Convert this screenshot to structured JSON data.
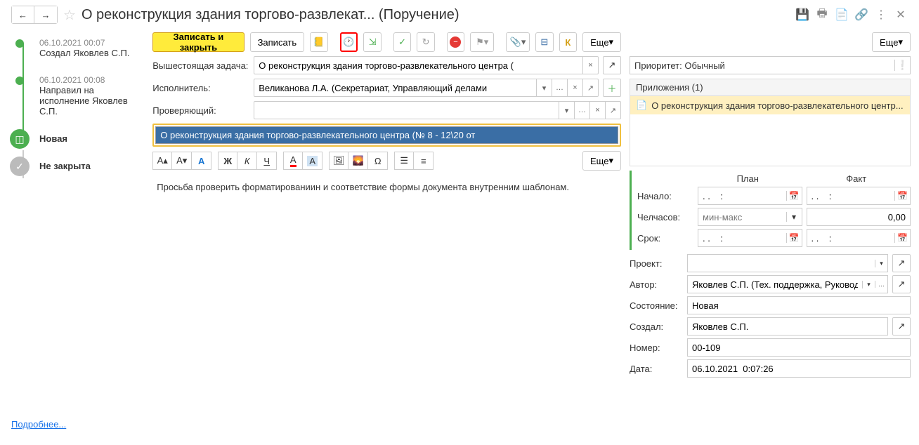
{
  "header": {
    "title": "О реконструкция здания торгово-развлекат... (Поручение)"
  },
  "timeline": {
    "items": [
      {
        "date": "06.10.2021 00:07",
        "text": "Создал Яковлев С.П."
      },
      {
        "date": "06.10.2021 00:08",
        "text": "Направил на исполнение Яковлев С.П."
      }
    ],
    "status_new": "Новая",
    "status_open": "Не закрыта",
    "more": "Подробнее..."
  },
  "toolbar": {
    "save_close": "Записать и закрыть",
    "save": "Записать",
    "more": "Еще"
  },
  "form": {
    "parent_label": "Вышестоящая задача:",
    "parent_value": "О реконструкция здания торгово-развлекательного центра (",
    "executor_label": "Исполнитель:",
    "executor_value": "Великанова Л.А. (Секретариат, Управляющий делами",
    "checker_label": "Проверяющий:",
    "checker_value": "",
    "subject": "О реконструкция здания торгово-развлекательного центра (№ 8 - 12\\20 от",
    "body": "Просьба проверить форматированиин и соответствие формы документа внутренним шаблонам."
  },
  "priority": {
    "label": "Приоритет:",
    "value": "Обычный"
  },
  "attachments": {
    "header": "Приложения (1)",
    "item": "О реконструкция здания торгово-развлекательного центр..."
  },
  "plan": {
    "col_plan": "План",
    "col_fact": "Факт",
    "start_label": "Начало:",
    "start_plan": ". .    :",
    "start_fact": ". .    :",
    "hours_label": "Челчасов:",
    "hours_placeholder": "мин-макс",
    "hours_fact": "0,00",
    "due_label": "Срок:",
    "due_plan": ". .    :",
    "due_fact": ". .    :"
  },
  "info": {
    "project_label": "Проект:",
    "project_value": "",
    "author_label": "Автор:",
    "author_value": "Яковлев С.П. (Тех. поддержка, Руководите",
    "state_label": "Состояние:",
    "state_value": "Новая",
    "creator_label": "Создал:",
    "creator_value": "Яковлев С.П.",
    "number_label": "Номер:",
    "number_value": "00-109",
    "date_label": "Дата:",
    "date_value": "06.10.2021  0:07:26"
  },
  "editor_more": "Еще"
}
